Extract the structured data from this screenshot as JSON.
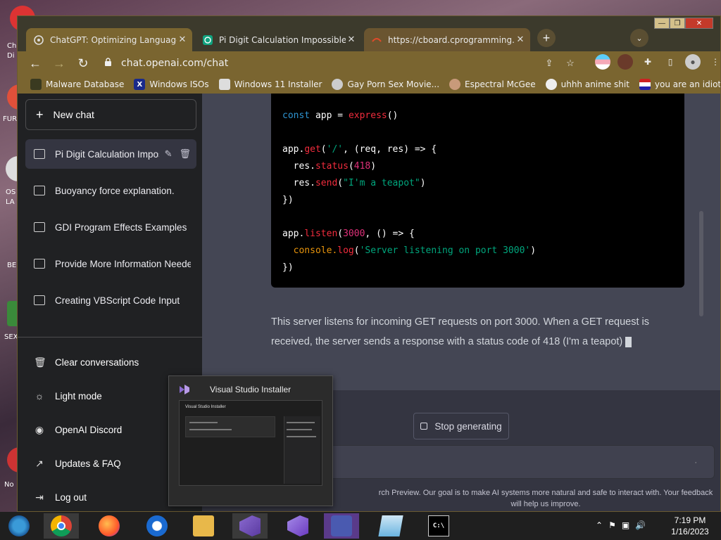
{
  "desktop": {
    "icon_labels": [
      "Ch",
      "Di",
      "FUR",
      "OS",
      "LA",
      "BE",
      "SEX",
      "No"
    ]
  },
  "browser": {
    "tabs": [
      {
        "title": "ChatGPT: Optimizing Language M",
        "close": "✕",
        "icon": "chatgpt-icon"
      },
      {
        "title": "Pi Digit Calculation Impossible",
        "close": "✕",
        "icon": "chatgpt-icon"
      },
      {
        "title": "https://cboard.cprogramming.com",
        "close": "✕",
        "icon": "loading-icon"
      }
    ],
    "new_tab": "+",
    "tab_menu": "⌄",
    "window_controls": {
      "minimize": "—",
      "restore": "❐",
      "close": "✕"
    },
    "nav": {
      "back": "←",
      "forward": "→",
      "reload": "↻"
    },
    "url": "chat.openai.com/chat",
    "bookmarks": [
      {
        "label": "Malware Database",
        "icon": "bookmark-icon"
      },
      {
        "label": "Windows ISOs",
        "icon": "x-icon"
      },
      {
        "label": "Windows 11 Installer",
        "icon": "image-icon"
      },
      {
        "label": "Gay Porn Sex Movie...",
        "icon": "face-icon"
      },
      {
        "label": "Espectral McGee",
        "icon": "avatar-icon"
      },
      {
        "label": "uhhh anime shit",
        "icon": "anime-icon"
      },
      {
        "label": "you are an idiot!",
        "icon": "flag-icon"
      }
    ]
  },
  "sidebar": {
    "new_chat": "New chat",
    "conversations": [
      {
        "title": "Pi Digit Calculation Impos",
        "active": true
      },
      {
        "title": "Buoyancy force explanation.",
        "active": false
      },
      {
        "title": "GDI Program Effects Examples",
        "active": false
      },
      {
        "title": "Provide More Information Neede",
        "active": false
      },
      {
        "title": "Creating VBScript Code Input",
        "active": false
      }
    ],
    "bottom": {
      "clear": "Clear conversations",
      "light_mode": "Light mode",
      "discord": "OpenAI Discord",
      "updates": "Updates & FAQ",
      "logout": "Log out"
    }
  },
  "main": {
    "code": {
      "line1_kw": "const",
      "line1_var": " app = ",
      "line1_fn": "express",
      "line1_end": "()",
      "get_obj": "app.",
      "get_fn": "get",
      "get_args_a": "(",
      "get_str": "'/'",
      "get_args_b": ", (req, res) => {",
      "status_obj": "  res.",
      "status_fn": "status",
      "status_open": "(",
      "status_num": "418",
      "status_close": ")",
      "send_obj": "  res.",
      "send_fn": "send",
      "send_open": "(",
      "send_str": "\"I'm a teapot\"",
      "send_close": ")",
      "close1": "})",
      "listen_obj": "app.",
      "listen_fn": "listen",
      "listen_open": "(",
      "listen_num": "3000",
      "listen_rest": ", () => {",
      "log_obj": "  console.",
      "log_fn": "log",
      "log_open": "(",
      "log_str": "'Server listening on port 3000'",
      "log_close": ")",
      "close2": "})"
    },
    "answer": "This server listens for incoming GET requests on port 3000. When a GET request is received, the server sends a response with a status code of 418 (I'm a teapot)",
    "stop_button": "Stop generating",
    "footnote": "rch Preview. Our goal is to make AI systems more natural and safe to interact with. Your feedback will help us improve."
  },
  "taskbar_preview": {
    "title": "Visual Studio Installer",
    "thumb_title": "Visual Studio Installer"
  },
  "taskbar": {
    "apps": [
      "windows-start-icon",
      "chrome-icon",
      "firefox-icon",
      "edge-icon",
      "file-explorer-icon",
      "vs-installer-icon",
      "visual-studio-icon",
      "teams-icon",
      "notepad-icon",
      "cmd-icon"
    ],
    "time": "7:19 PM",
    "date": "1/16/2023"
  }
}
